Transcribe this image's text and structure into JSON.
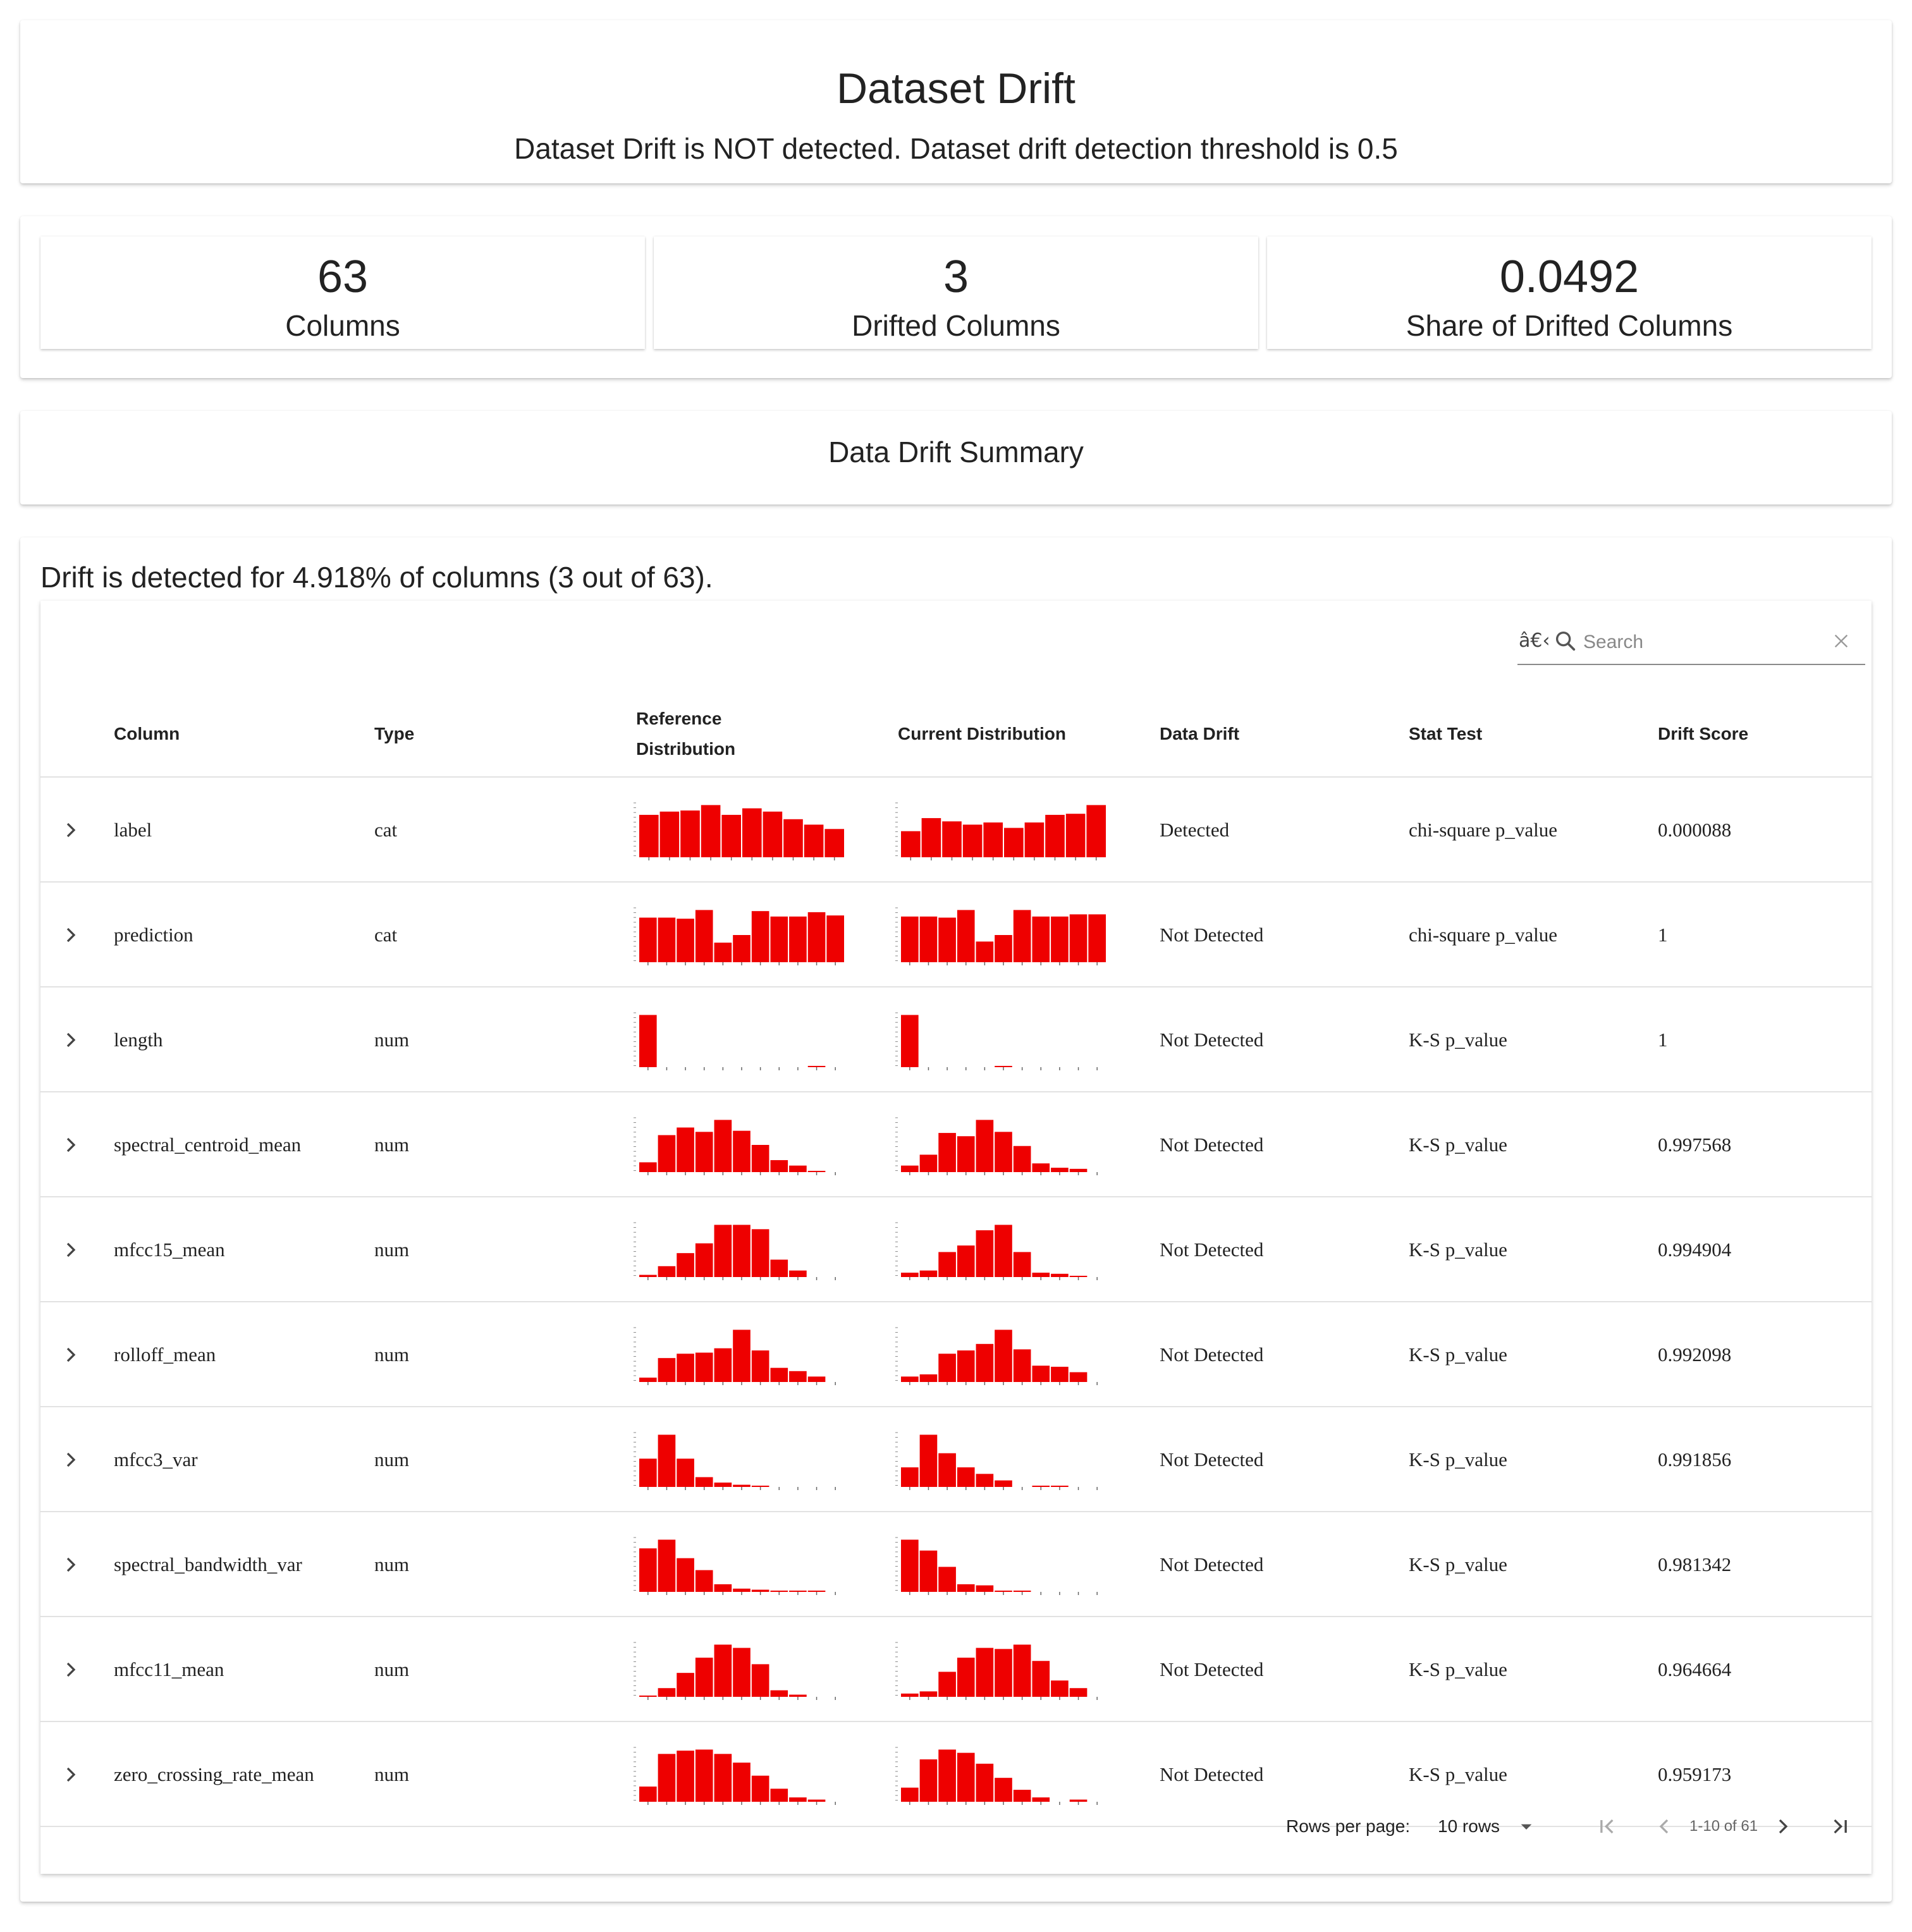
{
  "header": {
    "title": "Dataset Drift",
    "subtitle": "Dataset Drift is NOT detected. Dataset drift detection threshold is 0.5"
  },
  "metrics": [
    {
      "value": "63",
      "label": "Columns"
    },
    {
      "value": "3",
      "label": "Drifted Columns"
    },
    {
      "value": "0.0492",
      "label": "Share of Drifted Columns"
    }
  ],
  "summary_title": "Data Drift Summary",
  "summary_text": "Drift is detected for 4.918% of columns (3 out of 63).",
  "search": {
    "prefix": "â€‹",
    "placeholder": "Search"
  },
  "table": {
    "headers": {
      "column": "Column",
      "type": "Type",
      "reference_line1": "Reference",
      "reference_line2": "Distribution",
      "current": "Current Distribution",
      "data_drift": "Data Drift",
      "stat_test": "Stat Test",
      "drift_score": "Drift Score"
    },
    "bar_color": "#ee0000",
    "rows": [
      {
        "column": "label",
        "type": "cat",
        "drift": "Detected",
        "stat_test": "chi-square p_value",
        "score": "0.000088",
        "ref": [
          0.78,
          0.84,
          0.86,
          0.96,
          0.78,
          0.9,
          0.84,
          0.7,
          0.6,
          0.52
        ],
        "cur": [
          0.48,
          0.72,
          0.66,
          0.6,
          0.64,
          0.54,
          0.64,
          0.78,
          0.8,
          0.96
        ]
      },
      {
        "column": "prediction",
        "type": "cat",
        "drift": "Not Detected",
        "stat_test": "chi-square p_value",
        "score": "1",
        "ref": [
          0.82,
          0.82,
          0.8,
          0.96,
          0.36,
          0.5,
          0.94,
          0.84,
          0.84,
          0.92,
          0.86
        ],
        "cur": [
          0.84,
          0.84,
          0.82,
          0.96,
          0.38,
          0.5,
          0.96,
          0.84,
          0.84,
          0.88,
          0.88
        ]
      },
      {
        "column": "length",
        "type": "num",
        "drift": "Not Detected",
        "stat_test": "K-S p_value",
        "score": "1",
        "ref": [
          0.96,
          0,
          0,
          0,
          0,
          0,
          0,
          0,
          0,
          0.02,
          0
        ],
        "cur": [
          0.96,
          0,
          0,
          0,
          0,
          0.02,
          0,
          0,
          0,
          0,
          0
        ]
      },
      {
        "column": "spectral_centroid_mean",
        "type": "num",
        "drift": "Not Detected",
        "stat_test": "K-S p_value",
        "score": "0.997568",
        "ref": [
          0.18,
          0.68,
          0.82,
          0.74,
          0.96,
          0.76,
          0.5,
          0.22,
          0.12,
          0.02,
          0
        ],
        "cur": [
          0.12,
          0.32,
          0.72,
          0.66,
          0.96,
          0.74,
          0.48,
          0.16,
          0.08,
          0.06,
          0
        ]
      },
      {
        "column": "mfcc15_mean",
        "type": "num",
        "drift": "Not Detected",
        "stat_test": "K-S p_value",
        "score": "0.994904",
        "ref": [
          0.04,
          0.2,
          0.44,
          0.62,
          0.96,
          0.96,
          0.88,
          0.32,
          0.12,
          0,
          0
        ],
        "cur": [
          0.08,
          0.12,
          0.46,
          0.58,
          0.86,
          0.96,
          0.46,
          0.08,
          0.06,
          0.02,
          0
        ]
      },
      {
        "column": "rolloff_mean",
        "type": "num",
        "drift": "Not Detected",
        "stat_test": "K-S p_value",
        "score": "0.992098",
        "ref": [
          0.08,
          0.44,
          0.52,
          0.54,
          0.62,
          0.96,
          0.58,
          0.26,
          0.2,
          0.1,
          0
        ],
        "cur": [
          0.1,
          0.14,
          0.52,
          0.58,
          0.7,
          0.96,
          0.6,
          0.3,
          0.28,
          0.18,
          0
        ]
      },
      {
        "column": "mfcc3_var",
        "type": "num",
        "drift": "Not Detected",
        "stat_test": "K-S p_value",
        "score": "0.991856",
        "ref": [
          0.52,
          0.96,
          0.52,
          0.18,
          0.08,
          0.04,
          0.02,
          0,
          0,
          0,
          0
        ],
        "cur": [
          0.36,
          0.96,
          0.62,
          0.36,
          0.24,
          0.12,
          0,
          0.02,
          0.02,
          0,
          0
        ]
      },
      {
        "column": "spectral_bandwidth_var",
        "type": "num",
        "drift": "Not Detected",
        "stat_test": "K-S p_value",
        "score": "0.981342",
        "ref": [
          0.8,
          0.96,
          0.62,
          0.4,
          0.14,
          0.06,
          0.04,
          0.02,
          0.02,
          0.02,
          0
        ],
        "cur": [
          0.96,
          0.76,
          0.46,
          0.14,
          0.12,
          0.02,
          0.02,
          0,
          0,
          0,
          0
        ]
      },
      {
        "column": "mfcc11_mean",
        "type": "num",
        "drift": "Not Detected",
        "stat_test": "K-S p_value",
        "score": "0.964664",
        "ref": [
          0.02,
          0.16,
          0.44,
          0.72,
          0.96,
          0.9,
          0.6,
          0.12,
          0.04,
          0,
          0
        ],
        "cur": [
          0.06,
          0.1,
          0.46,
          0.72,
          0.9,
          0.88,
          0.96,
          0.66,
          0.3,
          0.16,
          0
        ]
      },
      {
        "column": "zero_crossing_rate_mean",
        "type": "num",
        "drift": "Not Detected",
        "stat_test": "K-S p_value",
        "score": "0.959173",
        "ref": [
          0.28,
          0.88,
          0.94,
          0.96,
          0.88,
          0.72,
          0.48,
          0.24,
          0.08,
          0.04,
          0
        ],
        "cur": [
          0.26,
          0.78,
          0.96,
          0.9,
          0.7,
          0.44,
          0.22,
          0.08,
          0,
          0.04,
          0
        ]
      }
    ]
  },
  "footer": {
    "rows_per_page_label": "Rows per page:",
    "rows_value": "10 rows",
    "range": "1-10 of 61"
  }
}
